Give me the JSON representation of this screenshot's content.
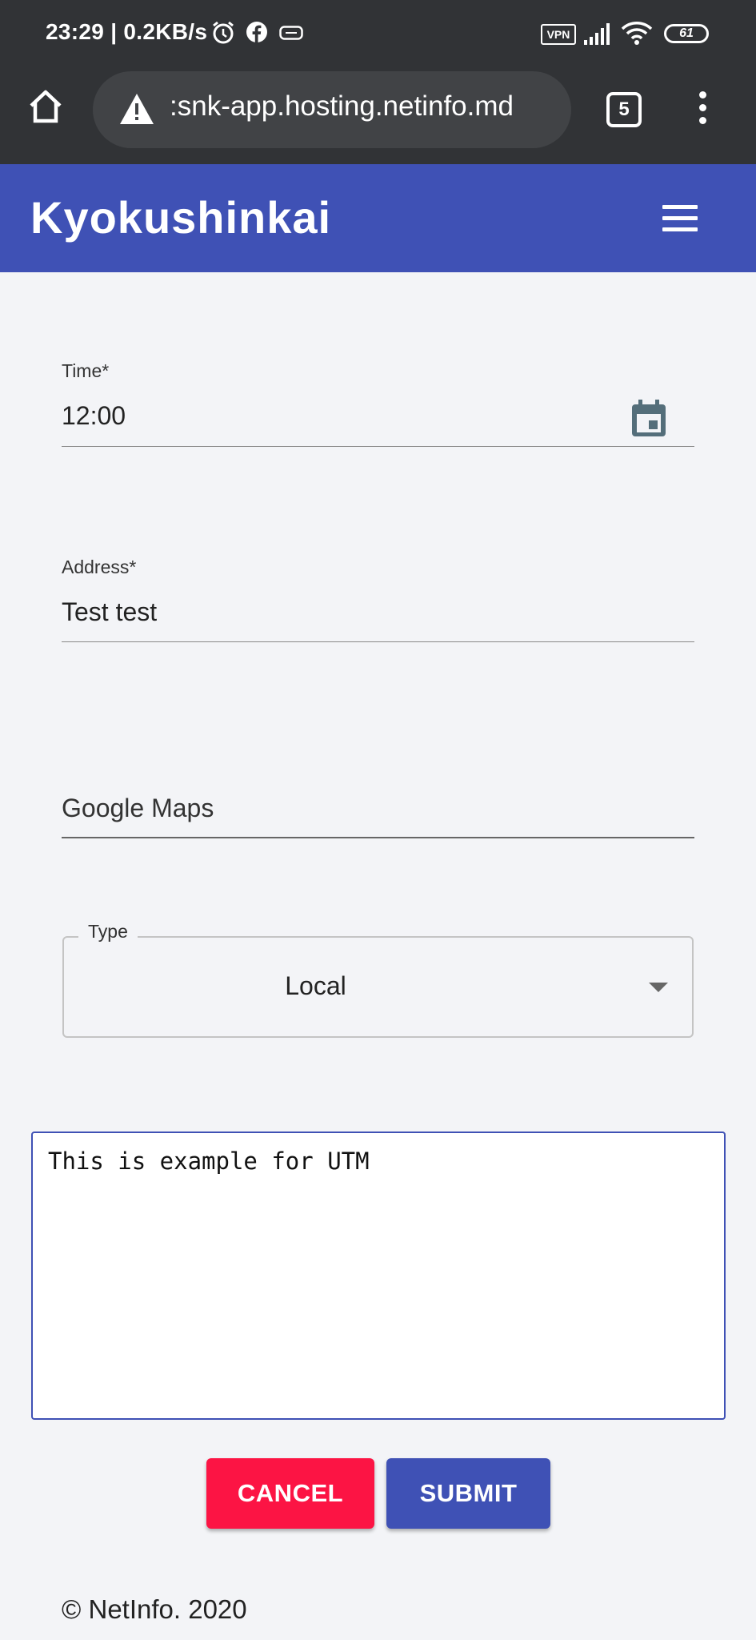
{
  "status_bar": {
    "time_speed": "23:29 | 0.2KB/s",
    "vpn": "VPN",
    "battery": "61"
  },
  "browser": {
    "url": ":snk-app.hosting.netinfo.md",
    "tab_count": "5"
  },
  "app": {
    "title": "Kyokushinkai"
  },
  "form": {
    "time": {
      "label": "Time*",
      "value": "12:00"
    },
    "address": {
      "label": "Address*",
      "value": "Test test"
    },
    "maps": {
      "placeholder": "Google Maps",
      "value": ""
    },
    "type": {
      "label": "Type",
      "value": "Local"
    },
    "description": {
      "value": "This is example for UTM"
    },
    "cancel_label": "CANCEL",
    "submit_label": "SUBMIT"
  },
  "footer": {
    "text": "© NetInfo. 2020"
  },
  "colors": {
    "primary": "#3f51b5",
    "cancel": "#fc1444",
    "status_bar": "#313336"
  }
}
